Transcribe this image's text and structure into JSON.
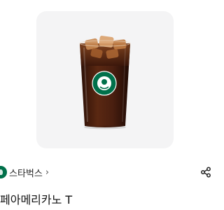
{
  "product": {
    "image_icon": "iced-americano-cup-image",
    "title": "페아메리카노 T"
  },
  "brand": {
    "logo_icon": "starbucks-logo-icon",
    "name": "스타벅스",
    "chevron": "›"
  },
  "actions": {
    "share_icon": "share-icon"
  },
  "colors": {
    "brand_green": "#00704a",
    "card_background": "#f4f4f5",
    "coffee": "#4a1f10"
  }
}
